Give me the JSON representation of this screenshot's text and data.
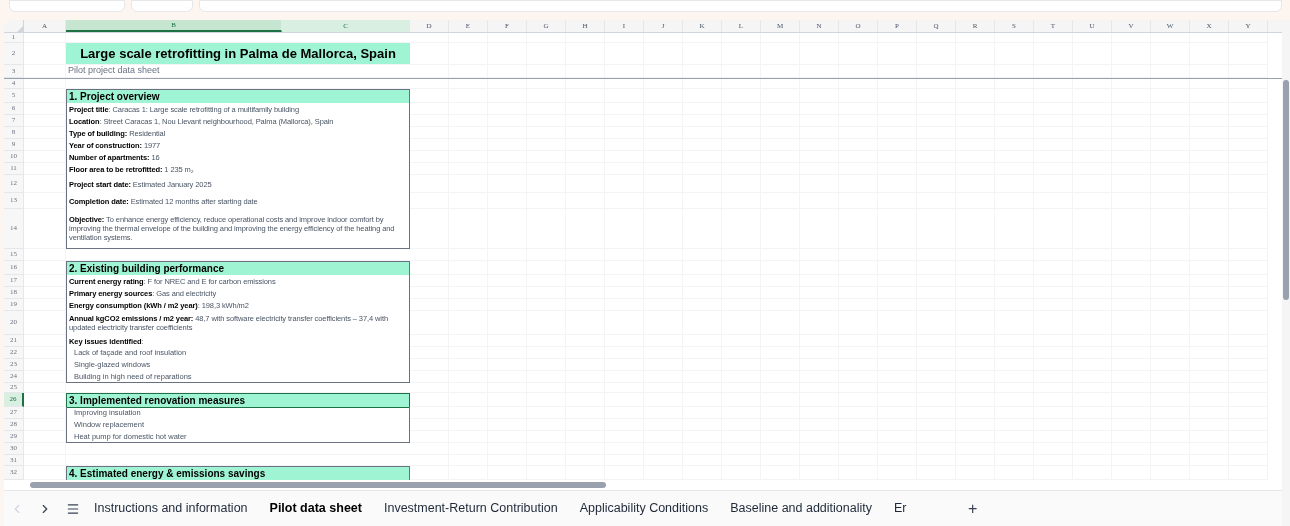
{
  "columns": [
    {
      "label": "A",
      "selected": false
    },
    {
      "label": "B",
      "selected": true
    },
    {
      "label": "C",
      "selected": true
    },
    {
      "label": "D",
      "selected": false
    },
    {
      "label": "E",
      "selected": false
    },
    {
      "label": "F",
      "selected": false
    },
    {
      "label": "G",
      "selected": false
    },
    {
      "label": "H",
      "selected": false
    },
    {
      "label": "I",
      "selected": false
    },
    {
      "label": "J",
      "selected": false
    },
    {
      "label": "K",
      "selected": false
    },
    {
      "label": "L",
      "selected": false
    },
    {
      "label": "M",
      "selected": false
    },
    {
      "label": "N",
      "selected": false
    },
    {
      "label": "O",
      "selected": false
    },
    {
      "label": "P",
      "selected": false
    },
    {
      "label": "Q",
      "selected": false
    },
    {
      "label": "R",
      "selected": false
    },
    {
      "label": "S",
      "selected": false
    },
    {
      "label": "T",
      "selected": false
    },
    {
      "label": "U",
      "selected": false
    },
    {
      "label": "V",
      "selected": false
    },
    {
      "label": "W",
      "selected": false
    },
    {
      "label": "X",
      "selected": false
    },
    {
      "label": "Y",
      "selected": false
    }
  ],
  "rows": [
    {
      "num": "1",
      "kind": "blank",
      "selected": false
    },
    {
      "num": "2",
      "kind": "title",
      "text": "Large scale retrofitting in Palma de Mallorca, Spain",
      "selected": false
    },
    {
      "num": "3",
      "kind": "subtitle",
      "text": "Pilot project data sheet",
      "selected": false
    },
    {
      "num": "4",
      "kind": "blank",
      "selected": false
    },
    {
      "num": "5",
      "kind": "section",
      "text": "1. Project overview",
      "selected": false
    },
    {
      "num": "6",
      "kind": "field",
      "label": "Project title",
      "value": ": Caracas 1: Large scale retrofitting of a multifamily building",
      "selected": false
    },
    {
      "num": "7",
      "kind": "field",
      "label": "Location",
      "value": ": Street Caracas 1, Nou Llevant neighbourhood, Palma (Mallorca), Spain",
      "selected": false
    },
    {
      "num": "8",
      "kind": "field",
      "label": "Type of building:",
      "value": " Residential",
      "selected": false
    },
    {
      "num": "9",
      "kind": "field",
      "label": "Year of construction:",
      "value": " 1977",
      "selected": false
    },
    {
      "num": "10",
      "kind": "field",
      "label": "Number of apartments:",
      "value": " 16",
      "selected": false
    },
    {
      "num": "11",
      "kind": "field",
      "label": "Floor area to be retrofitted:",
      "value": " 1 235 m₂",
      "selected": false
    },
    {
      "num": "12",
      "kind": "field",
      "label": "Project start date:",
      "value": " Estimated January 2025",
      "selected": false
    },
    {
      "num": "13",
      "kind": "field",
      "label": "Completion date:",
      "value": " Estimated 12 months after starting date",
      "selected": false
    },
    {
      "num": "14",
      "kind": "field",
      "label": "Objective:",
      "value": " To enhance energy efficiency, reduce operational costs and improve indoor comfort by improving the thermal envelope of the building and improving the energy efficiency of the heating and ventilation systems.",
      "selected": false
    },
    {
      "num": "15",
      "kind": "blank",
      "selected": false
    },
    {
      "num": "16",
      "kind": "section",
      "text": "2. Existing building performance",
      "selected": false
    },
    {
      "num": "17",
      "kind": "field",
      "label": "Current energy rating",
      "value": ": F for NREC and E for carbon emissions",
      "selected": false
    },
    {
      "num": "18",
      "kind": "field",
      "label": "Primary energy sources",
      "value": ": Gas and electricity",
      "selected": false
    },
    {
      "num": "19",
      "kind": "field",
      "label": "Energy consumption (kWh / m2 year)",
      "value": ": 198,3 kWh/m2",
      "selected": false
    },
    {
      "num": "20",
      "kind": "field",
      "label": "Annual kgCO2 emissions / m2 year:",
      "value": " 48,7 with software electricity transfer coefficients – 37,4 with updated electricity transfer coefficients",
      "selected": false
    },
    {
      "num": "21",
      "kind": "field",
      "label": "Key issues identified",
      "value": ":",
      "selected": false
    },
    {
      "num": "22",
      "kind": "bullet",
      "text": "Lack of façade and roof insulation",
      "selected": false
    },
    {
      "num": "23",
      "kind": "bullet",
      "text": "Single-glazed windows",
      "selected": false
    },
    {
      "num": "24",
      "kind": "bullet",
      "text": "Building in high need of reparations",
      "selected": false
    },
    {
      "num": "25",
      "kind": "blank",
      "selected": false
    },
    {
      "num": "26",
      "kind": "section",
      "text": "3. Implemented renovation measures",
      "selected": true
    },
    {
      "num": "27",
      "kind": "bullet",
      "text": "Improving insulation",
      "selected": false
    },
    {
      "num": "28",
      "kind": "bullet",
      "text": "Window replacement",
      "selected": false
    },
    {
      "num": "29",
      "kind": "bullet",
      "text": "Heat pump for domestic hot water",
      "selected": false
    },
    {
      "num": "30",
      "kind": "blank",
      "selected": false
    },
    {
      "num": "31",
      "kind": "blank",
      "selected": false
    },
    {
      "num": "32",
      "kind": "section",
      "text": "4. Estimated energy & emissions savings",
      "selected": false
    }
  ],
  "sheet_tabs": [
    {
      "label": "Instructions and information",
      "selected": false
    },
    {
      "label": "Pilot data sheet",
      "selected": true
    },
    {
      "label": "Investment-Return Contribution",
      "selected": false
    },
    {
      "label": "Applicability Conditions",
      "selected": false
    },
    {
      "label": "Baseline and additionality",
      "selected": false
    },
    {
      "label": "Er",
      "selected": false
    }
  ],
  "add_sheet": "+"
}
